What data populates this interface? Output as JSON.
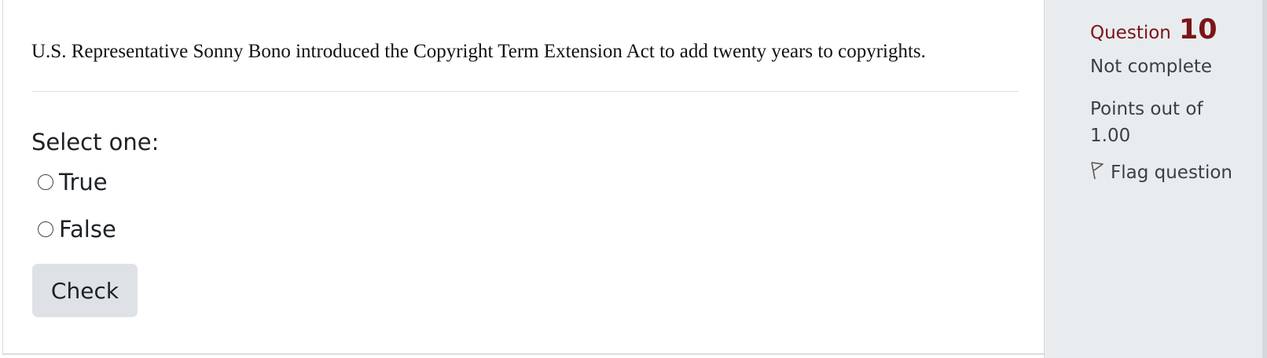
{
  "question": {
    "text": "U.S. Representative Sonny Bono introduced the Copyright Term Extension Act to add twenty years to copyrights.",
    "prompt": "Select one:",
    "options": [
      {
        "label": "True"
      },
      {
        "label": "False"
      }
    ],
    "check_label": "Check"
  },
  "info": {
    "question_word": "Question",
    "question_number": "10",
    "state": "Not complete",
    "grade": "Points out of 1.00",
    "flag_label": "Flag question",
    "accent_color": "#7b1416"
  },
  "icons": {
    "flag": "flag-icon",
    "radio": "radio-circle"
  }
}
